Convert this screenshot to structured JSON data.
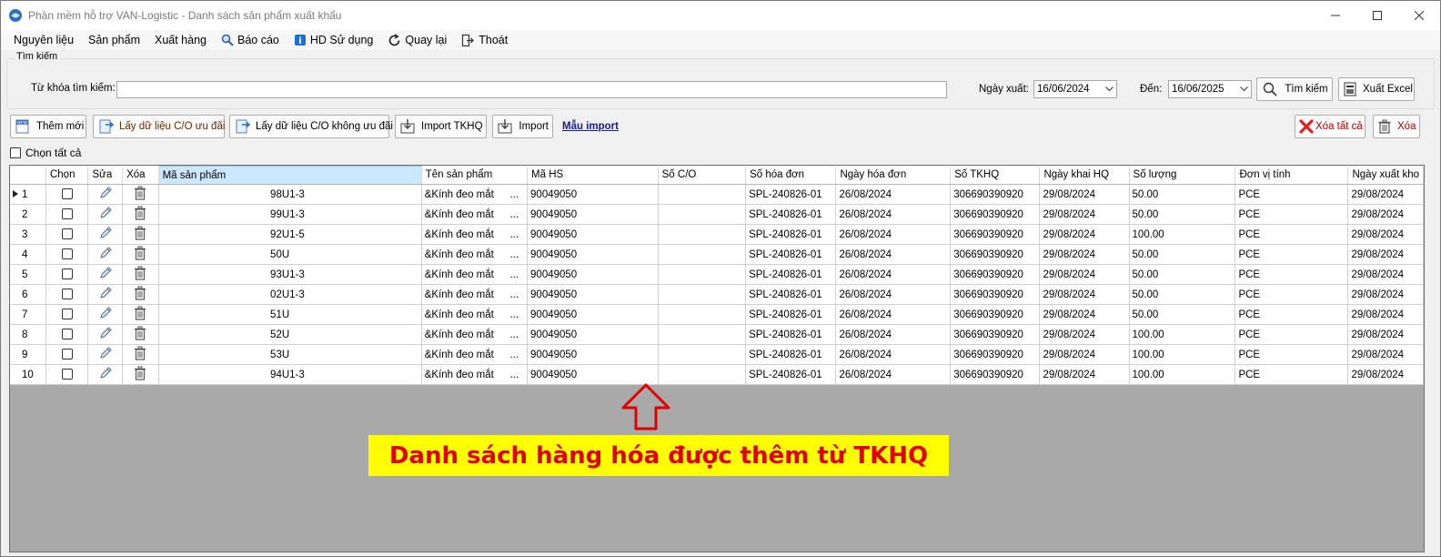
{
  "window": {
    "title": "Phần mềm hỗ trợ VAN-Logistic - Danh sách sản phẩm xuất khẩu",
    "controls": [
      "minimize-icon",
      "maximize-icon",
      "close-icon"
    ]
  },
  "menu": {
    "items": [
      {
        "label": "Nguyên liệu",
        "icon": ""
      },
      {
        "label": "Sản phẩm",
        "icon": ""
      },
      {
        "label": "Xuất hàng",
        "icon": ""
      },
      {
        "label": "Báo cáo",
        "icon": "magnifier-icon"
      },
      {
        "label": "HD Sử dụng",
        "icon": "info-icon"
      },
      {
        "label": "Quay lại",
        "icon": "refresh-icon"
      },
      {
        "label": "Thoát",
        "icon": "exit-icon"
      }
    ]
  },
  "search": {
    "group_title": "Tìm kiếm",
    "keyword_label": "Từ khóa tìm kiếm:",
    "keyword_value": "",
    "date_label": "Ngày xuất:",
    "date_from": "16/06/2024",
    "to_label": "Đến:",
    "date_to": "16/06/2025",
    "search_button": "Tìm kiếm",
    "export_button": "Xuất Excel"
  },
  "toolbar": {
    "add_new": "Thêm mới",
    "get_co_pref": "Lấy dữ liệu C/O ưu đãi",
    "get_co_nonpref": "Lấy dữ liệu C/O không ưu đãi",
    "import_tkhq": "Import TKHQ",
    "import": "Import",
    "import_template_link": "Mẫu import",
    "delete_all": "Xóa tất cả",
    "delete": "Xóa",
    "select_all": "Chọn tất cả"
  },
  "grid": {
    "columns": [
      "Chọn",
      "Sửa",
      "Xóa",
      "Mã sản phẩm",
      "Tên sản phẩm",
      "Mã HS",
      "Số C/O",
      "Số hóa đơn",
      "Ngày hóa đơn",
      "Số TKHQ",
      "Ngày khai HQ",
      "Số lượng",
      "Đơn vị tính",
      "Ngày xuất kho"
    ],
    "rows": [
      {
        "no": "1",
        "code": "98U1-3",
        "name": "&Kính đeo mắt",
        "ellipsis": "...",
        "hs": "90049050",
        "co": "",
        "invoice": "SPL-240826-01",
        "invoice_date": "26/08/2024",
        "tkhq": "306690390920",
        "declare_date": "29/08/2024",
        "qty": "50.00",
        "unit": "PCE",
        "export_date": "29/08/2024"
      },
      {
        "no": "2",
        "code": "99U1-3",
        "name": "&Kính đeo mắt",
        "ellipsis": "...",
        "hs": "90049050",
        "co": "",
        "invoice": "SPL-240826-01",
        "invoice_date": "26/08/2024",
        "tkhq": "306690390920",
        "declare_date": "29/08/2024",
        "qty": "50.00",
        "unit": "PCE",
        "export_date": "29/08/2024"
      },
      {
        "no": "3",
        "code": "92U1-5",
        "name": "&Kính đeo mắt",
        "ellipsis": "...",
        "hs": "90049050",
        "co": "",
        "invoice": "SPL-240826-01",
        "invoice_date": "26/08/2024",
        "tkhq": "306690390920",
        "declare_date": "29/08/2024",
        "qty": "100.00",
        "unit": "PCE",
        "export_date": "29/08/2024"
      },
      {
        "no": "4",
        "code": "50U",
        "name": "&Kính đeo mắt",
        "ellipsis": "...",
        "hs": "90049050",
        "co": "",
        "invoice": "SPL-240826-01",
        "invoice_date": "26/08/2024",
        "tkhq": "306690390920",
        "declare_date": "29/08/2024",
        "qty": "50.00",
        "unit": "PCE",
        "export_date": "29/08/2024"
      },
      {
        "no": "5",
        "code": "93U1-3",
        "name": "&Kính đeo mắt",
        "ellipsis": "...",
        "hs": "90049050",
        "co": "",
        "invoice": "SPL-240826-01",
        "invoice_date": "26/08/2024",
        "tkhq": "306690390920",
        "declare_date": "29/08/2024",
        "qty": "50.00",
        "unit": "PCE",
        "export_date": "29/08/2024"
      },
      {
        "no": "6",
        "code": "02U1-3",
        "name": "&Kính đeo mắt",
        "ellipsis": "...",
        "hs": "90049050",
        "co": "",
        "invoice": "SPL-240826-01",
        "invoice_date": "26/08/2024",
        "tkhq": "306690390920",
        "declare_date": "29/08/2024",
        "qty": "50.00",
        "unit": "PCE",
        "export_date": "29/08/2024"
      },
      {
        "no": "7",
        "code": "51U",
        "name": "&Kính đeo mắt",
        "ellipsis": "...",
        "hs": "90049050",
        "co": "",
        "invoice": "SPL-240826-01",
        "invoice_date": "26/08/2024",
        "tkhq": "306690390920",
        "declare_date": "29/08/2024",
        "qty": "50.00",
        "unit": "PCE",
        "export_date": "29/08/2024"
      },
      {
        "no": "8",
        "code": "52U",
        "name": "&Kính đeo mắt",
        "ellipsis": "...",
        "hs": "90049050",
        "co": "",
        "invoice": "SPL-240826-01",
        "invoice_date": "26/08/2024",
        "tkhq": "306690390920",
        "declare_date": "29/08/2024",
        "qty": "100.00",
        "unit": "PCE",
        "export_date": "29/08/2024"
      },
      {
        "no": "9",
        "code": "53U",
        "name": "&Kính đeo mắt",
        "ellipsis": "...",
        "hs": "90049050",
        "co": "",
        "invoice": "SPL-240826-01",
        "invoice_date": "26/08/2024",
        "tkhq": "306690390920",
        "declare_date": "29/08/2024",
        "qty": "100.00",
        "unit": "PCE",
        "export_date": "29/08/2024"
      },
      {
        "no": "10",
        "code": "94U1-3",
        "name": "&Kính đeo mắt",
        "ellipsis": "...",
        "hs": "90049050",
        "co": "",
        "invoice": "SPL-240826-01",
        "invoice_date": "26/08/2024",
        "tkhq": "306690390920",
        "declare_date": "29/08/2024",
        "qty": "100.00",
        "unit": "PCE",
        "export_date": "29/08/2024"
      }
    ]
  },
  "annotation": {
    "text": "Danh sách hàng hóa được thêm từ TKHQ",
    "arrow_color": "#e00000",
    "highlight_color": "#ffff00"
  }
}
